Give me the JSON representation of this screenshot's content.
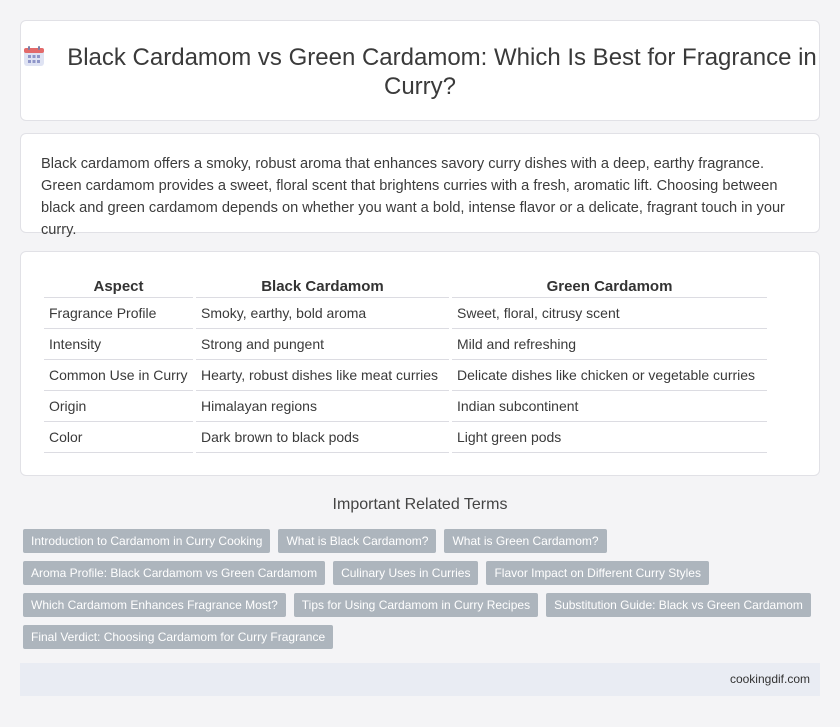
{
  "header": {
    "icon": "calendar-icon",
    "title": "Black Cardamom vs Green Cardamom: Which Is Best for Fragrance in Curry?"
  },
  "intro": {
    "text": "Black cardamom offers a smoky, robust aroma that enhances savory curry dishes with a deep, earthy fragrance. Green cardamom provides a sweet, floral scent that brightens curries with a fresh, aromatic lift. Choosing between black and green cardamom depends on whether you want a bold, intense flavor or a delicate, fragrant touch in your curry."
  },
  "table": {
    "headers": [
      "Aspect",
      "Black Cardamom",
      "Green Cardamom"
    ],
    "rows": [
      [
        "Fragrance Profile",
        "Smoky, earthy, bold aroma",
        "Sweet, floral, citrusy scent"
      ],
      [
        "Intensity",
        "Strong and pungent",
        "Mild and refreshing"
      ],
      [
        "Common Use in Curry",
        "Hearty, robust dishes like meat curries",
        "Delicate dishes like chicken or vegetable curries"
      ],
      [
        "Origin",
        "Himalayan regions",
        "Indian subcontinent"
      ],
      [
        "Color",
        "Dark brown to black pods",
        "Light green pods"
      ]
    ]
  },
  "related": {
    "title": "Important Related Terms",
    "tags": [
      [
        "Introduction to Cardamom in Curry Cooking",
        "What is Black Cardamom?",
        "What is Green Cardamom?"
      ],
      [
        "Aroma Profile: Black Cardamom vs Green Cardamom",
        "Culinary Uses in Curries",
        "Flavor Impact on Different Curry Styles"
      ],
      [
        "Which Cardamom Enhances Fragrance Most?",
        "Tips for Using Cardamom in Curry Recipes",
        "Substitution Guide: Black vs Green Cardamom"
      ],
      [
        "Final Verdict: Choosing Cardamom for Curry Fragrance"
      ]
    ]
  },
  "footer": {
    "site": "cookingdif.com"
  },
  "colors": {
    "tag_bg": "#adb5bd",
    "footer_bg": "#e9ecf3",
    "page_bg": "#f4f4f6"
  }
}
